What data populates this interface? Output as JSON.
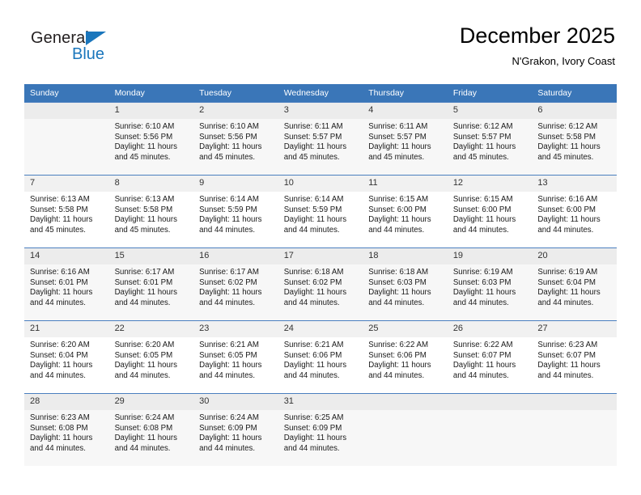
{
  "logo": {
    "text_top": "General",
    "text_bottom": "Blue",
    "triangle_color": "#1a76bc",
    "top_color": "#231f20",
    "bottom_color": "#1a76bc"
  },
  "header": {
    "title": "December 2025",
    "subtitle": "N'Grakon, Ivory Coast"
  },
  "theme": {
    "header_row_bg": "#3a76b8",
    "header_row_text": "#ffffff",
    "daynum_bg": "#f1f1f1",
    "row_shaded_bg": "#f7f7f7",
    "grid_line": "#4a7fbf"
  },
  "weekdays": [
    "Sunday",
    "Monday",
    "Tuesday",
    "Wednesday",
    "Thursday",
    "Friday",
    "Saturday"
  ],
  "weeks": [
    {
      "shaded": true,
      "days": [
        {
          "empty": true
        },
        {
          "num": "1",
          "sunrise": "Sunrise: 6:10 AM",
          "sunset": "Sunset: 5:56 PM",
          "daylight1": "Daylight: 11 hours",
          "daylight2": "and 45 minutes."
        },
        {
          "num": "2",
          "sunrise": "Sunrise: 6:10 AM",
          "sunset": "Sunset: 5:56 PM",
          "daylight1": "Daylight: 11 hours",
          "daylight2": "and 45 minutes."
        },
        {
          "num": "3",
          "sunrise": "Sunrise: 6:11 AM",
          "sunset": "Sunset: 5:57 PM",
          "daylight1": "Daylight: 11 hours",
          "daylight2": "and 45 minutes."
        },
        {
          "num": "4",
          "sunrise": "Sunrise: 6:11 AM",
          "sunset": "Sunset: 5:57 PM",
          "daylight1": "Daylight: 11 hours",
          "daylight2": "and 45 minutes."
        },
        {
          "num": "5",
          "sunrise": "Sunrise: 6:12 AM",
          "sunset": "Sunset: 5:57 PM",
          "daylight1": "Daylight: 11 hours",
          "daylight2": "and 45 minutes."
        },
        {
          "num": "6",
          "sunrise": "Sunrise: 6:12 AM",
          "sunset": "Sunset: 5:58 PM",
          "daylight1": "Daylight: 11 hours",
          "daylight2": "and 45 minutes."
        }
      ]
    },
    {
      "shaded": false,
      "days": [
        {
          "num": "7",
          "sunrise": "Sunrise: 6:13 AM",
          "sunset": "Sunset: 5:58 PM",
          "daylight1": "Daylight: 11 hours",
          "daylight2": "and 45 minutes."
        },
        {
          "num": "8",
          "sunrise": "Sunrise: 6:13 AM",
          "sunset": "Sunset: 5:58 PM",
          "daylight1": "Daylight: 11 hours",
          "daylight2": "and 45 minutes."
        },
        {
          "num": "9",
          "sunrise": "Sunrise: 6:14 AM",
          "sunset": "Sunset: 5:59 PM",
          "daylight1": "Daylight: 11 hours",
          "daylight2": "and 44 minutes."
        },
        {
          "num": "10",
          "sunrise": "Sunrise: 6:14 AM",
          "sunset": "Sunset: 5:59 PM",
          "daylight1": "Daylight: 11 hours",
          "daylight2": "and 44 minutes."
        },
        {
          "num": "11",
          "sunrise": "Sunrise: 6:15 AM",
          "sunset": "Sunset: 6:00 PM",
          "daylight1": "Daylight: 11 hours",
          "daylight2": "and 44 minutes."
        },
        {
          "num": "12",
          "sunrise": "Sunrise: 6:15 AM",
          "sunset": "Sunset: 6:00 PM",
          "daylight1": "Daylight: 11 hours",
          "daylight2": "and 44 minutes."
        },
        {
          "num": "13",
          "sunrise": "Sunrise: 6:16 AM",
          "sunset": "Sunset: 6:00 PM",
          "daylight1": "Daylight: 11 hours",
          "daylight2": "and 44 minutes."
        }
      ]
    },
    {
      "shaded": true,
      "days": [
        {
          "num": "14",
          "sunrise": "Sunrise: 6:16 AM",
          "sunset": "Sunset: 6:01 PM",
          "daylight1": "Daylight: 11 hours",
          "daylight2": "and 44 minutes."
        },
        {
          "num": "15",
          "sunrise": "Sunrise: 6:17 AM",
          "sunset": "Sunset: 6:01 PM",
          "daylight1": "Daylight: 11 hours",
          "daylight2": "and 44 minutes."
        },
        {
          "num": "16",
          "sunrise": "Sunrise: 6:17 AM",
          "sunset": "Sunset: 6:02 PM",
          "daylight1": "Daylight: 11 hours",
          "daylight2": "and 44 minutes."
        },
        {
          "num": "17",
          "sunrise": "Sunrise: 6:18 AM",
          "sunset": "Sunset: 6:02 PM",
          "daylight1": "Daylight: 11 hours",
          "daylight2": "and 44 minutes."
        },
        {
          "num": "18",
          "sunrise": "Sunrise: 6:18 AM",
          "sunset": "Sunset: 6:03 PM",
          "daylight1": "Daylight: 11 hours",
          "daylight2": "and 44 minutes."
        },
        {
          "num": "19",
          "sunrise": "Sunrise: 6:19 AM",
          "sunset": "Sunset: 6:03 PM",
          "daylight1": "Daylight: 11 hours",
          "daylight2": "and 44 minutes."
        },
        {
          "num": "20",
          "sunrise": "Sunrise: 6:19 AM",
          "sunset": "Sunset: 6:04 PM",
          "daylight1": "Daylight: 11 hours",
          "daylight2": "and 44 minutes."
        }
      ]
    },
    {
      "shaded": false,
      "days": [
        {
          "num": "21",
          "sunrise": "Sunrise: 6:20 AM",
          "sunset": "Sunset: 6:04 PM",
          "daylight1": "Daylight: 11 hours",
          "daylight2": "and 44 minutes."
        },
        {
          "num": "22",
          "sunrise": "Sunrise: 6:20 AM",
          "sunset": "Sunset: 6:05 PM",
          "daylight1": "Daylight: 11 hours",
          "daylight2": "and 44 minutes."
        },
        {
          "num": "23",
          "sunrise": "Sunrise: 6:21 AM",
          "sunset": "Sunset: 6:05 PM",
          "daylight1": "Daylight: 11 hours",
          "daylight2": "and 44 minutes."
        },
        {
          "num": "24",
          "sunrise": "Sunrise: 6:21 AM",
          "sunset": "Sunset: 6:06 PM",
          "daylight1": "Daylight: 11 hours",
          "daylight2": "and 44 minutes."
        },
        {
          "num": "25",
          "sunrise": "Sunrise: 6:22 AM",
          "sunset": "Sunset: 6:06 PM",
          "daylight1": "Daylight: 11 hours",
          "daylight2": "and 44 minutes."
        },
        {
          "num": "26",
          "sunrise": "Sunrise: 6:22 AM",
          "sunset": "Sunset: 6:07 PM",
          "daylight1": "Daylight: 11 hours",
          "daylight2": "and 44 minutes."
        },
        {
          "num": "27",
          "sunrise": "Sunrise: 6:23 AM",
          "sunset": "Sunset: 6:07 PM",
          "daylight1": "Daylight: 11 hours",
          "daylight2": "and 44 minutes."
        }
      ]
    },
    {
      "shaded": true,
      "days": [
        {
          "num": "28",
          "sunrise": "Sunrise: 6:23 AM",
          "sunset": "Sunset: 6:08 PM",
          "daylight1": "Daylight: 11 hours",
          "daylight2": "and 44 minutes."
        },
        {
          "num": "29",
          "sunrise": "Sunrise: 6:24 AM",
          "sunset": "Sunset: 6:08 PM",
          "daylight1": "Daylight: 11 hours",
          "daylight2": "and 44 minutes."
        },
        {
          "num": "30",
          "sunrise": "Sunrise: 6:24 AM",
          "sunset": "Sunset: 6:09 PM",
          "daylight1": "Daylight: 11 hours",
          "daylight2": "and 44 minutes."
        },
        {
          "num": "31",
          "sunrise": "Sunrise: 6:25 AM",
          "sunset": "Sunset: 6:09 PM",
          "daylight1": "Daylight: 11 hours",
          "daylight2": "and 44 minutes."
        },
        {
          "empty": true
        },
        {
          "empty": true
        },
        {
          "empty": true
        }
      ]
    }
  ]
}
